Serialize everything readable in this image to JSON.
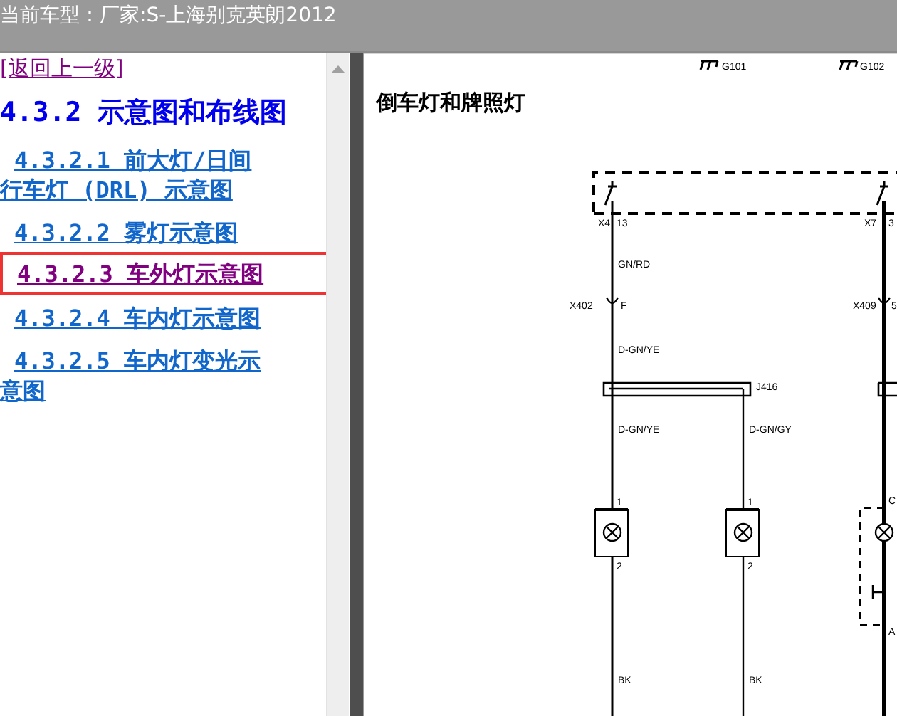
{
  "header": {
    "title": "当前车型：厂家:S-上海别克英朗2012"
  },
  "nav": {
    "back_link": "[返回上一级]",
    "heading": "4.3.2 示意图和布线图",
    "items": [
      {
        "label": "4.3.2.1 前大灯/日间行车灯 (DRL) 示意图",
        "selected": false
      },
      {
        "label": "4.3.2.2 雾灯示意图",
        "selected": false
      },
      {
        "label": "4.3.2.3 车外灯示意图",
        "selected": true
      },
      {
        "label": "4.3.2.4 车内灯示意图",
        "selected": false
      },
      {
        "label": "4.3.2.5 车内灯变光示意图",
        "selected": false
      }
    ]
  },
  "document": {
    "title": "倒车灯和牌照灯",
    "diagram_labels": [
      "G101",
      "G102",
      "X4",
      "13",
      "X7",
      "3",
      "GN/RD",
      "X402",
      "F",
      "X409",
      "5",
      "D-GN/YE",
      "J416",
      "D-GN/YE",
      "D-GN/GY",
      "1",
      "2",
      "1",
      "2",
      "C",
      "A",
      "BK",
      "BK"
    ]
  }
}
